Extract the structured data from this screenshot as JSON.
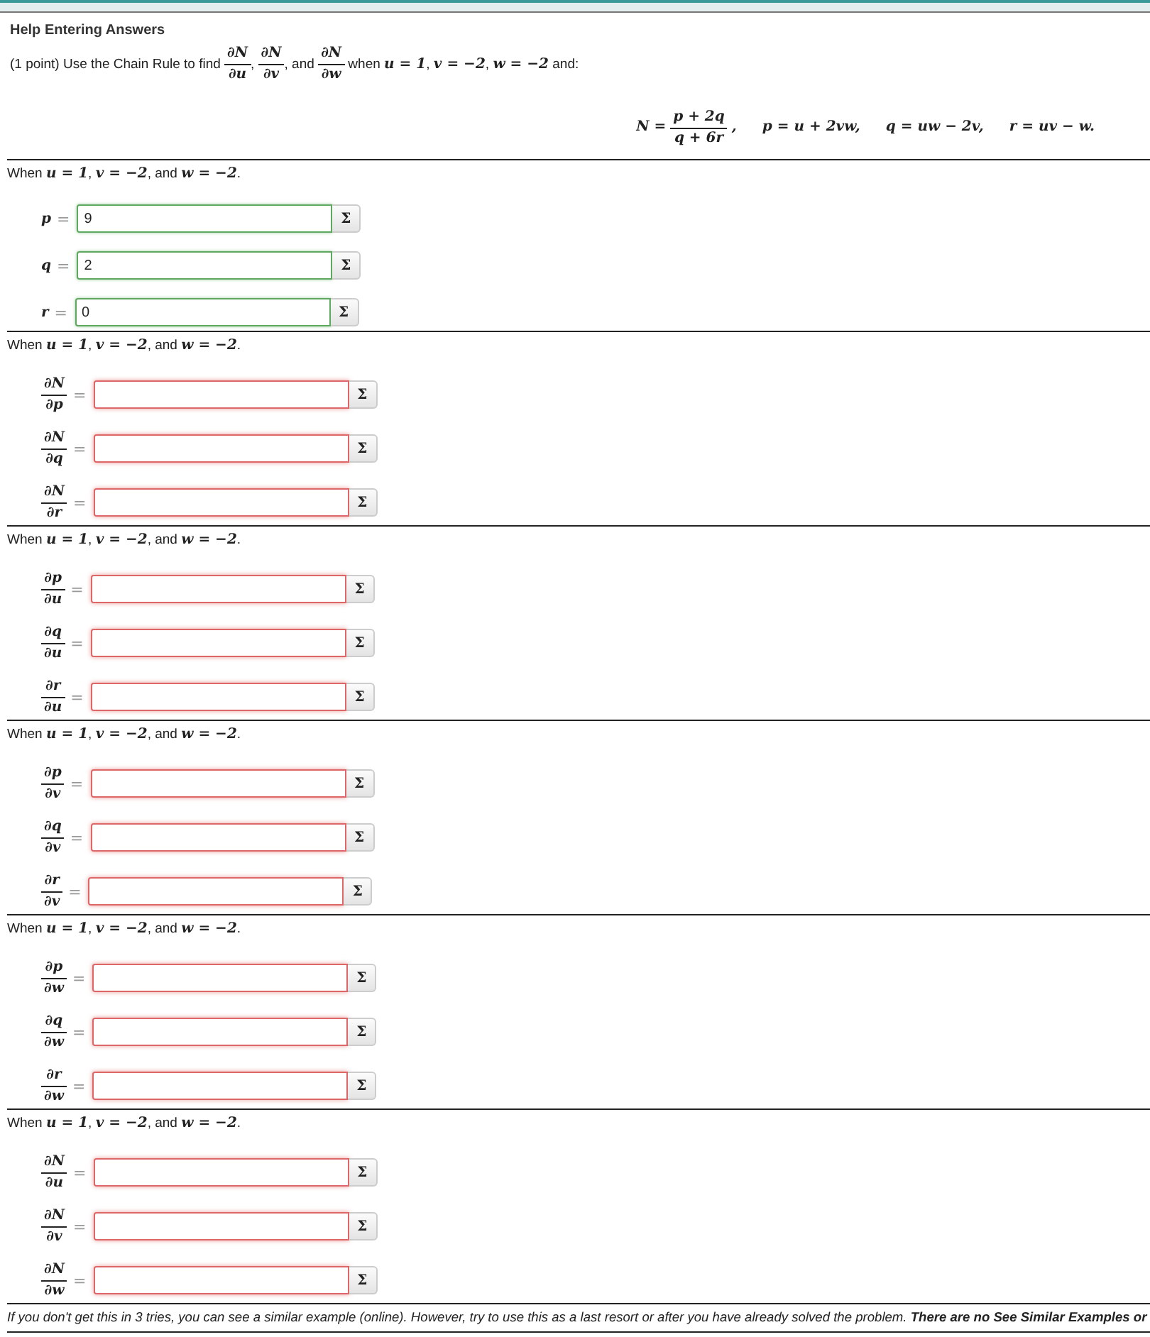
{
  "help_link": "Help Entering Answers",
  "question": [
    {
      "kind": "text",
      "s": "(1 point) Use the Chain Rule to find "
    },
    {
      "kind": "frac",
      "num": "∂N",
      "den": "∂u"
    },
    {
      "kind": "text",
      "s": ", "
    },
    {
      "kind": "frac",
      "num": "∂N",
      "den": "∂v"
    },
    {
      "kind": "text",
      "s": ", and "
    },
    {
      "kind": "frac",
      "num": "∂N",
      "den": "∂w"
    },
    {
      "kind": "text",
      "s": " when **u = 1**, **v = −2**, **w = −2** and:"
    }
  ],
  "formula": [
    [
      {
        "kind": "math",
        "s": "N ="
      },
      {
        "kind": "frac",
        "num": "p + 2q",
        "den": "q + 6r"
      },
      {
        "kind": "math",
        "s": ","
      }
    ],
    [
      {
        "kind": "math",
        "s": "p = u + 2vw,"
      }
    ],
    [
      {
        "kind": "math",
        "s": "q = uw − 2v,"
      }
    ],
    [
      {
        "kind": "math",
        "s": "r = uv − w."
      }
    ]
  ],
  "sections": [
    {
      "condition": "When **u = 1**, **v = −2**, and **w = −2**.",
      "rows": [
        {
          "kind": "var",
          "label": "p",
          "rel": "=",
          "value": "9",
          "correct": true,
          "button": "Σ"
        },
        {
          "kind": "var",
          "label": "q",
          "rel": "=",
          "value": "2",
          "correct": true,
          "button": "Σ"
        },
        {
          "kind": "var",
          "label": "r",
          "rel": "=",
          "value": "0",
          "correct": true,
          "button": "Σ"
        }
      ]
    },
    {
      "condition": "When **u = 1**, **v = −2**, and **w = −2**.",
      "rows": [
        {
          "kind": "frac",
          "num": "∂N",
          "den": "∂p",
          "rel": "=",
          "correct": false,
          "button": "Σ"
        },
        {
          "kind": "frac",
          "num": "∂N",
          "den": "∂q",
          "rel": "=",
          "correct": false,
          "button": "Σ"
        },
        {
          "kind": "frac",
          "num": "∂N",
          "den": "∂r",
          "rel": "=",
          "correct": false,
          "button": "Σ"
        }
      ]
    },
    {
      "condition": "When **u = 1**, **v = −2**, and **w = −2**.",
      "rows": [
        {
          "kind": "frac",
          "num": "∂p",
          "den": "∂u",
          "rel": "=",
          "correct": false,
          "button": "Σ"
        },
        {
          "kind": "frac",
          "num": "∂q",
          "den": "∂u",
          "rel": "=",
          "correct": false,
          "button": "Σ"
        },
        {
          "kind": "frac",
          "num": "∂r",
          "den": "∂u",
          "rel": "=",
          "correct": false,
          "button": "Σ"
        }
      ]
    },
    {
      "condition": "When **u = 1**, **v = −2**, and **w = −2**.",
      "rows": [
        {
          "kind": "frac",
          "num": "∂p",
          "den": "∂v",
          "rel": "=",
          "correct": false,
          "button": "Σ"
        },
        {
          "kind": "frac",
          "num": "∂q",
          "den": "∂v",
          "rel": "=",
          "correct": false,
          "button": "Σ"
        },
        {
          "kind": "frac",
          "num": "∂r",
          "den": "∂v",
          "rel": "=",
          "correct": false,
          "button": "Σ"
        }
      ]
    },
    {
      "condition": "When **u = 1**, **v = −2**, and **w = −2**.",
      "rows": [
        {
          "kind": "frac",
          "num": "∂p",
          "den": "∂w",
          "rel": "=",
          "correct": false,
          "button": "Σ"
        },
        {
          "kind": "frac",
          "num": "∂q",
          "den": "∂w",
          "rel": "=",
          "correct": false,
          "button": "Σ"
        },
        {
          "kind": "frac",
          "num": "∂r",
          "den": "∂w",
          "rel": "=",
          "correct": false,
          "button": "Σ"
        }
      ]
    },
    {
      "condition": "When **u = 1**, **v = −2**, and **w = −2**.",
      "rows": [
        {
          "kind": "frac",
          "num": "∂N",
          "den": "∂u",
          "rel": "=",
          "correct": false,
          "button": "Σ"
        },
        {
          "kind": "frac",
          "num": "∂N",
          "den": "∂v",
          "rel": "=",
          "correct": false,
          "button": "Σ"
        },
        {
          "kind": "frac",
          "num": "∂N",
          "den": "∂w",
          "rel": "=",
          "correct": false,
          "button": "Σ"
        }
      ]
    }
  ],
  "note": "If you don't get this in 3 tries, you can see a similar example (online). However, try to use this as a last resort or after you have already solved the problem. **There are no See Similar Examples or**"
}
